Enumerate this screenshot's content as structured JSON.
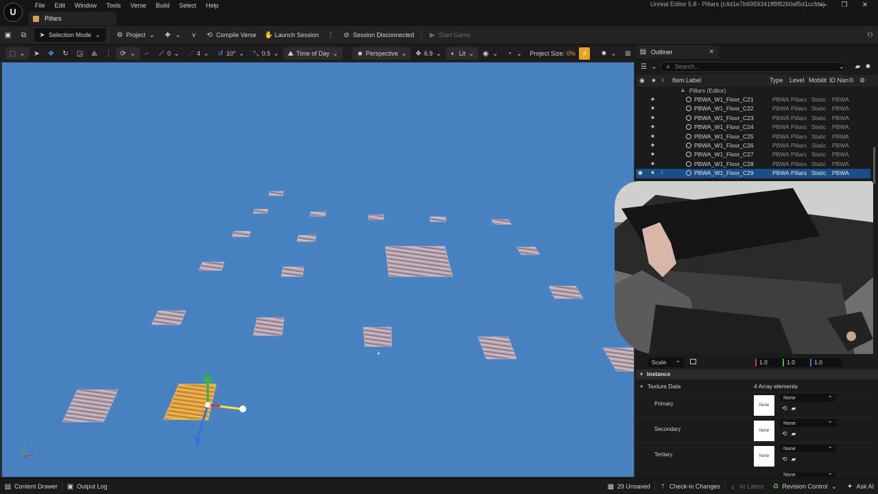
{
  "app": {
    "logo_text": "U",
    "title": "Unreal Editor 5.8 - Pillars (c4d1e7b6959341ff8f8260af5d1ccfde)",
    "document_tab": "Pillars",
    "menu": [
      "File",
      "Edit",
      "Window",
      "Tools",
      "Verse",
      "Build",
      "Select",
      "Help"
    ],
    "window_controls": [
      "—",
      "❐",
      "✕"
    ]
  },
  "toolbar": {
    "selection_mode": "Selection Mode",
    "project": "Project",
    "compile_verse": "Compile Verse",
    "launch_session": "Launch Session",
    "session_status": "Session Disconnected",
    "start_game": "Start Game"
  },
  "viewport_toolbar": {
    "snap_grid": "0",
    "snap_move": "4",
    "snap_rotate": "10°",
    "snap_scale": "0.5",
    "time_of_day": "Time of Day",
    "perspective": "Perspective",
    "camera_speed": "6.9",
    "view_mode": "Lit",
    "project_size_label": "Project Size:",
    "project_size_value": "0%"
  },
  "viewport": {
    "background": "#4a81c1",
    "selected_tile_color": "#e2a640"
  },
  "outliner": {
    "tab_label": "Outliner",
    "search_placeholder": "Search...",
    "columns": [
      "Item Label",
      "Type",
      "Level",
      "Mobilit",
      "ID Nan"
    ],
    "root_label": "Pillars (Editor)",
    "rows": [
      {
        "name": "PBWA_W1_Floor_C21",
        "type": "PBWA",
        "level": "Pillars",
        "mobility": "Static",
        "id": "PBWA"
      },
      {
        "name": "PBWA_W1_Floor_C22",
        "type": "PBWA",
        "level": "Pillars",
        "mobility": "Static",
        "id": "PBWA"
      },
      {
        "name": "PBWA_W1_Floor_C23",
        "type": "PBWA",
        "level": "Pillars",
        "mobility": "Static",
        "id": "PBWA"
      },
      {
        "name": "PBWA_W1_Floor_C24",
        "type": "PBWA",
        "level": "Pillars",
        "mobility": "Static",
        "id": "PBWA"
      },
      {
        "name": "PBWA_W1_Floor_C25",
        "type": "PBWA",
        "level": "Pillars",
        "mobility": "Static",
        "id": "PBWA"
      },
      {
        "name": "PBWA_W1_Floor_C26",
        "type": "PBWA",
        "level": "Pillars",
        "mobility": "Static",
        "id": "PBWA"
      },
      {
        "name": "PBWA_W1_Floor_C27",
        "type": "PBWA",
        "level": "Pillars",
        "mobility": "Static",
        "id": "PBWA"
      },
      {
        "name": "PBWA_W1_Floor_C28",
        "type": "PBWA",
        "level": "Pillars",
        "mobility": "Static",
        "id": "PBWA"
      },
      {
        "name": "PBWA_W1_Floor_C29",
        "type": "PBWA",
        "level": "Pillars",
        "mobility": "Static",
        "id": "PBWA",
        "selected": true
      }
    ]
  },
  "details": {
    "scale_mode": "Scale",
    "scale": {
      "x": "1.0",
      "y": "1.0",
      "z": "1.0"
    },
    "section_instance": "Instance",
    "texture_data_label": "Texture Data",
    "texture_data_count": "4 Array elements",
    "texture_slots": [
      {
        "label": "Primary",
        "thumb": "None",
        "value": "None"
      },
      {
        "label": "Secondary",
        "thumb": "None",
        "value": "None"
      },
      {
        "label": "Tertiary",
        "thumb": "None",
        "value": "None"
      }
    ],
    "partial_last_value": "None"
  },
  "statusbar": {
    "content_drawer": "Content Drawer",
    "output_log": "Output Log",
    "unsaved": "29 Unsaved",
    "check_in": "Check-in Changes",
    "at_latest": "At Latest",
    "revision_control": "Revision Control",
    "ask_ai": "Ask AI"
  }
}
